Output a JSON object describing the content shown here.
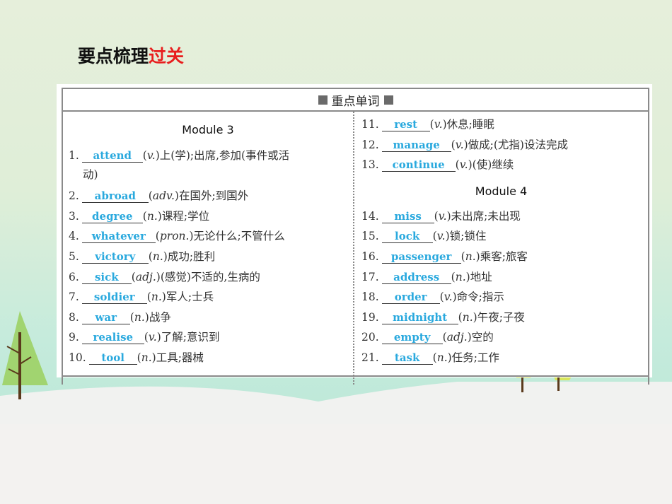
{
  "page": {
    "title_main": "要点梳理",
    "title_accent": "过关",
    "accent_color": "#e81e1e",
    "answer_color": "#2aa9de"
  },
  "table": {
    "header": "重点单词",
    "header_icon": "square-bullet-icon"
  },
  "modules": [
    {
      "heading": "Module 3",
      "items": [
        {
          "num": "1.",
          "word": "attend",
          "pos": "v.",
          "def": "上(学);出席,参加(事件或活",
          "def_cont": "动)"
        },
        {
          "num": "2.",
          "word": "abroad",
          "pos": "adv.",
          "def": "在国外;到国外"
        },
        {
          "num": "3.",
          "word": "degree",
          "pos": "n.",
          "def": "课程;学位"
        },
        {
          "num": "4.",
          "word": "whatever",
          "pos": "pron.",
          "def": "无论什么;不管什么"
        },
        {
          "num": "5.",
          "word": "victory",
          "pos": "n.",
          "def": "成功;胜利"
        },
        {
          "num": "6.",
          "word": "sick",
          "pos": "adj.",
          "def": "(感觉)不适的,生病的"
        },
        {
          "num": "7.",
          "word": "soldier",
          "pos": "n.",
          "def": "军人;士兵"
        },
        {
          "num": "8.",
          "word": "war",
          "pos": "n.",
          "def": "战争"
        },
        {
          "num": "9.",
          "word": "realise",
          "pos": "v.",
          "def": "了解;意识到"
        },
        {
          "num": "10.",
          "word": "tool",
          "pos": "n.",
          "def": "工具;器械"
        }
      ]
    },
    {
      "heading": "Module 4",
      "pre_items": [
        {
          "num": "11.",
          "word": "rest",
          "pos": "v.",
          "def": "休息;睡眠"
        },
        {
          "num": "12.",
          "word": "manage",
          "pos": "v.",
          "def": "做成;(尤指)设法完成"
        },
        {
          "num": "13.",
          "word": "continue",
          "pos": "v.",
          "def": "(使)继续"
        }
      ],
      "items": [
        {
          "num": "14.",
          "word": "miss",
          "pos": "v.",
          "def": "未出席;未出现"
        },
        {
          "num": "15.",
          "word": "lock",
          "pos": "v.",
          "def": "锁;锁住"
        },
        {
          "num": "16.",
          "word": "passenger",
          "pos": "n.",
          "def": "乘客;旅客"
        },
        {
          "num": "17.",
          "word": "address",
          "pos": "n.",
          "def": "地址"
        },
        {
          "num": "18.",
          "word": "order",
          "pos": "v.",
          "def": "命令;指示"
        },
        {
          "num": "19.",
          "word": "midnight",
          "pos": "n.",
          "def": "午夜;子夜"
        },
        {
          "num": "20.",
          "word": "empty",
          "pos": "adj.",
          "def": "空的"
        },
        {
          "num": "21.",
          "word": "task",
          "pos": "n.",
          "def": "任务;工作"
        }
      ]
    }
  ]
}
